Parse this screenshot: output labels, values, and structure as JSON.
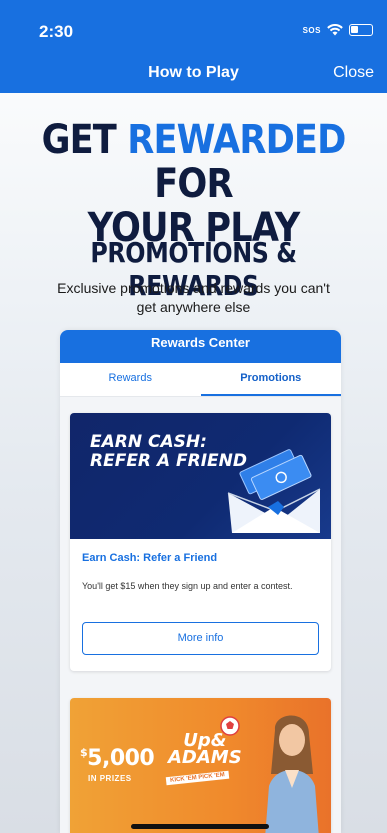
{
  "status": {
    "time": "2:30",
    "sos": "SOS"
  },
  "nav": {
    "title": "How to Play",
    "close": "Close"
  },
  "headline": {
    "line1_a": "GET ",
    "line1_accent": "REWARDED",
    "line1_b": " FOR",
    "line2": "YOUR PLAY"
  },
  "section": {
    "title": "PROMOTIONS & REWARDS",
    "description": "Exclusive promotions and rewards you can't get anywhere else"
  },
  "rewards_center": {
    "title": "Rewards Center",
    "tabs": [
      {
        "label": "Rewards",
        "active": false
      },
      {
        "label": "Promotions",
        "active": true
      }
    ]
  },
  "promo1": {
    "banner_line1": "EARN CASH:",
    "banner_line2": "REFER A FRIEND",
    "title": "Earn Cash: Refer a Friend",
    "description": "You'll get $15 when they sign up and enter a contest.",
    "button": "More info"
  },
  "promo2": {
    "dollar": "$",
    "amount": "5,000",
    "prize_label": "IN PRIZES",
    "brand_line1": "Up&",
    "brand_line2": "ADAMS",
    "tagline": "KICK 'EM PICK 'EM"
  },
  "colors": {
    "brand_blue": "#1870e0",
    "navy": "#0f1c3f",
    "orange": "#f08a2c"
  }
}
